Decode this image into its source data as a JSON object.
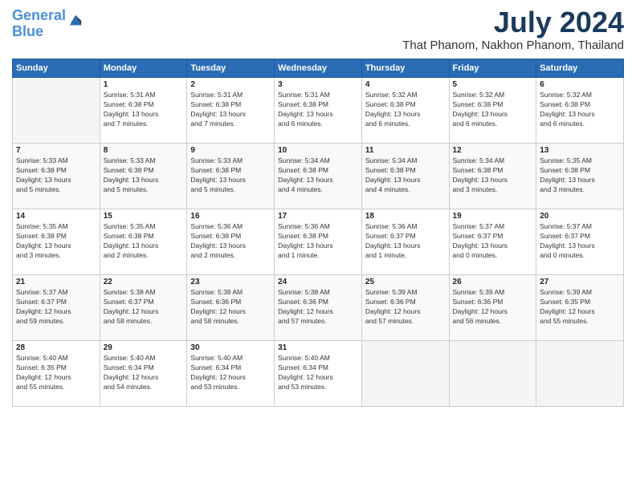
{
  "logo": {
    "line1": "General",
    "line2": "Blue"
  },
  "title": "July 2024",
  "location": "That Phanom, Nakhon Phanom, Thailand",
  "headers": [
    "Sunday",
    "Monday",
    "Tuesday",
    "Wednesday",
    "Thursday",
    "Friday",
    "Saturday"
  ],
  "weeks": [
    [
      {
        "day": "",
        "info": ""
      },
      {
        "day": "1",
        "info": "Sunrise: 5:31 AM\nSunset: 6:38 PM\nDaylight: 13 hours\nand 7 minutes."
      },
      {
        "day": "2",
        "info": "Sunrise: 5:31 AM\nSunset: 6:38 PM\nDaylight: 13 hours\nand 7 minutes."
      },
      {
        "day": "3",
        "info": "Sunrise: 5:31 AM\nSunset: 6:38 PM\nDaylight: 13 hours\nand 6 minutes."
      },
      {
        "day": "4",
        "info": "Sunrise: 5:32 AM\nSunset: 6:38 PM\nDaylight: 13 hours\nand 6 minutes."
      },
      {
        "day": "5",
        "info": "Sunrise: 5:32 AM\nSunset: 6:38 PM\nDaylight: 13 hours\nand 6 minutes."
      },
      {
        "day": "6",
        "info": "Sunrise: 5:32 AM\nSunset: 6:38 PM\nDaylight: 13 hours\nand 6 minutes."
      }
    ],
    [
      {
        "day": "7",
        "info": "Sunrise: 5:33 AM\nSunset: 6:38 PM\nDaylight: 13 hours\nand 5 minutes."
      },
      {
        "day": "8",
        "info": "Sunrise: 5:33 AM\nSunset: 6:38 PM\nDaylight: 13 hours\nand 5 minutes."
      },
      {
        "day": "9",
        "info": "Sunrise: 5:33 AM\nSunset: 6:38 PM\nDaylight: 13 hours\nand 5 minutes."
      },
      {
        "day": "10",
        "info": "Sunrise: 5:34 AM\nSunset: 6:38 PM\nDaylight: 13 hours\nand 4 minutes."
      },
      {
        "day": "11",
        "info": "Sunrise: 5:34 AM\nSunset: 6:38 PM\nDaylight: 13 hours\nand 4 minutes."
      },
      {
        "day": "12",
        "info": "Sunrise: 5:34 AM\nSunset: 6:38 PM\nDaylight: 13 hours\nand 3 minutes."
      },
      {
        "day": "13",
        "info": "Sunrise: 5:35 AM\nSunset: 6:38 PM\nDaylight: 13 hours\nand 3 minutes."
      }
    ],
    [
      {
        "day": "14",
        "info": "Sunrise: 5:35 AM\nSunset: 6:38 PM\nDaylight: 13 hours\nand 3 minutes."
      },
      {
        "day": "15",
        "info": "Sunrise: 5:35 AM\nSunset: 6:38 PM\nDaylight: 13 hours\nand 2 minutes."
      },
      {
        "day": "16",
        "info": "Sunrise: 5:36 AM\nSunset: 6:38 PM\nDaylight: 13 hours\nand 2 minutes."
      },
      {
        "day": "17",
        "info": "Sunrise: 5:36 AM\nSunset: 6:38 PM\nDaylight: 13 hours\nand 1 minute."
      },
      {
        "day": "18",
        "info": "Sunrise: 5:36 AM\nSunset: 6:37 PM\nDaylight: 13 hours\nand 1 minute."
      },
      {
        "day": "19",
        "info": "Sunrise: 5:37 AM\nSunset: 6:37 PM\nDaylight: 13 hours\nand 0 minutes."
      },
      {
        "day": "20",
        "info": "Sunrise: 5:37 AM\nSunset: 6:37 PM\nDaylight: 13 hours\nand 0 minutes."
      }
    ],
    [
      {
        "day": "21",
        "info": "Sunrise: 5:37 AM\nSunset: 6:37 PM\nDaylight: 12 hours\nand 59 minutes."
      },
      {
        "day": "22",
        "info": "Sunrise: 5:38 AM\nSunset: 6:37 PM\nDaylight: 12 hours\nand 58 minutes."
      },
      {
        "day": "23",
        "info": "Sunrise: 5:38 AM\nSunset: 6:36 PM\nDaylight: 12 hours\nand 58 minutes."
      },
      {
        "day": "24",
        "info": "Sunrise: 5:38 AM\nSunset: 6:36 PM\nDaylight: 12 hours\nand 57 minutes."
      },
      {
        "day": "25",
        "info": "Sunrise: 5:39 AM\nSunset: 6:36 PM\nDaylight: 12 hours\nand 57 minutes."
      },
      {
        "day": "26",
        "info": "Sunrise: 5:39 AM\nSunset: 6:36 PM\nDaylight: 12 hours\nand 56 minutes."
      },
      {
        "day": "27",
        "info": "Sunrise: 5:39 AM\nSunset: 6:35 PM\nDaylight: 12 hours\nand 55 minutes."
      }
    ],
    [
      {
        "day": "28",
        "info": "Sunrise: 5:40 AM\nSunset: 6:35 PM\nDaylight: 12 hours\nand 55 minutes."
      },
      {
        "day": "29",
        "info": "Sunrise: 5:40 AM\nSunset: 6:34 PM\nDaylight: 12 hours\nand 54 minutes."
      },
      {
        "day": "30",
        "info": "Sunrise: 5:40 AM\nSunset: 6:34 PM\nDaylight: 12 hours\nand 53 minutes."
      },
      {
        "day": "31",
        "info": "Sunrise: 5:40 AM\nSunset: 6:34 PM\nDaylight: 12 hours\nand 53 minutes."
      },
      {
        "day": "",
        "info": ""
      },
      {
        "day": "",
        "info": ""
      },
      {
        "day": "",
        "info": ""
      }
    ]
  ]
}
